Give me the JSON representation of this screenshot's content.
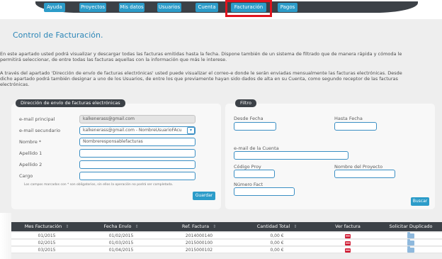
{
  "nav": {
    "tabs": [
      "Ayuda",
      "Proyectos",
      "Mis datos",
      "Usuarios",
      "Cuenta",
      "Facturación",
      "Pagos"
    ],
    "highlighted": "Facturación"
  },
  "page": {
    "title": "Control de Facturación.",
    "para1_line1": "En este apartado usted podrá visualizar y descargar todas las facturas emitidas hasta la fecha. Dispone también de un sistema de filtrado que de manera rápida y cómoda le",
    "para1_line2": "permitirá seleccionar, de entre todas las facturas aquellas con la información que más le interese.",
    "para2_line1": "A través del apartado 'Dirección de envío de facturas electrónicas' usted puede visualizar el correo-e donde le serán enviadas mensualmente las facturas electrónicas. Desde",
    "para2_line2": "dicho apartado podrá también designar a uno de los Usuarios, de entre los que previamente hayan sido dados de alta en su Cuenta, como segundo receptor de las facturas",
    "para2_line3": "electrónicas."
  },
  "direccion": {
    "tab": "Dirección de envío de facturas electrónicas",
    "email_principal_label": "e-mail principal",
    "email_principal_value": "kalkenerass@gmail.com",
    "email_secundario_label": "e-mail secundario",
    "email_secundario_value": "kalkenerass@gmail.com - NombreUsuarioFAcu",
    "nombre_label": "Nombre *",
    "nombre_value": "Nombreresponsablefacturas",
    "apellido1_label": "Apellido 1",
    "apellido2_label": "Apellido 2",
    "cargo_label": "Cargo",
    "note": "Los campos marcados con * son obligatorios, sin ellos la operación no podrá ser completada.",
    "save_label": "Guardar"
  },
  "filtro": {
    "tab": "Filtro",
    "desde_label": "Desde Fecha",
    "hasta_label": "Hasta Fecha",
    "email_cuenta_label": "e-mail de la Cuenta",
    "codigo_label": "Código Proy",
    "nombre_proyecto_label": "Nombre del Proyecto",
    "numero_label": "Número Fact",
    "buscar_label": "Buscar"
  },
  "table": {
    "columns": [
      "Mes Facturación",
      "Fecha Envío",
      "Ref. Factura",
      "Cantidad Total",
      "Ver factura",
      "Solicitar Duplicado"
    ],
    "sortable": [
      true,
      true,
      true,
      true,
      false,
      false
    ],
    "rows": [
      {
        "mes": "01/2015",
        "fecha": "01/02/2015",
        "ref": "2014000140",
        "cantidad": "0,00 €"
      },
      {
        "mes": "02/2015",
        "fecha": "01/03/2015",
        "ref": "2015000100",
        "cantidad": "0,00 €"
      },
      {
        "mes": "03/2015",
        "fecha": "01/04/2015",
        "ref": "2015000102",
        "cantidad": "0,00 €"
      }
    ]
  },
  "colors": {
    "accent": "#2c9cc9",
    "title": "#2c86b7",
    "dark_band": "#3c4147",
    "highlight": "#e0141e"
  }
}
